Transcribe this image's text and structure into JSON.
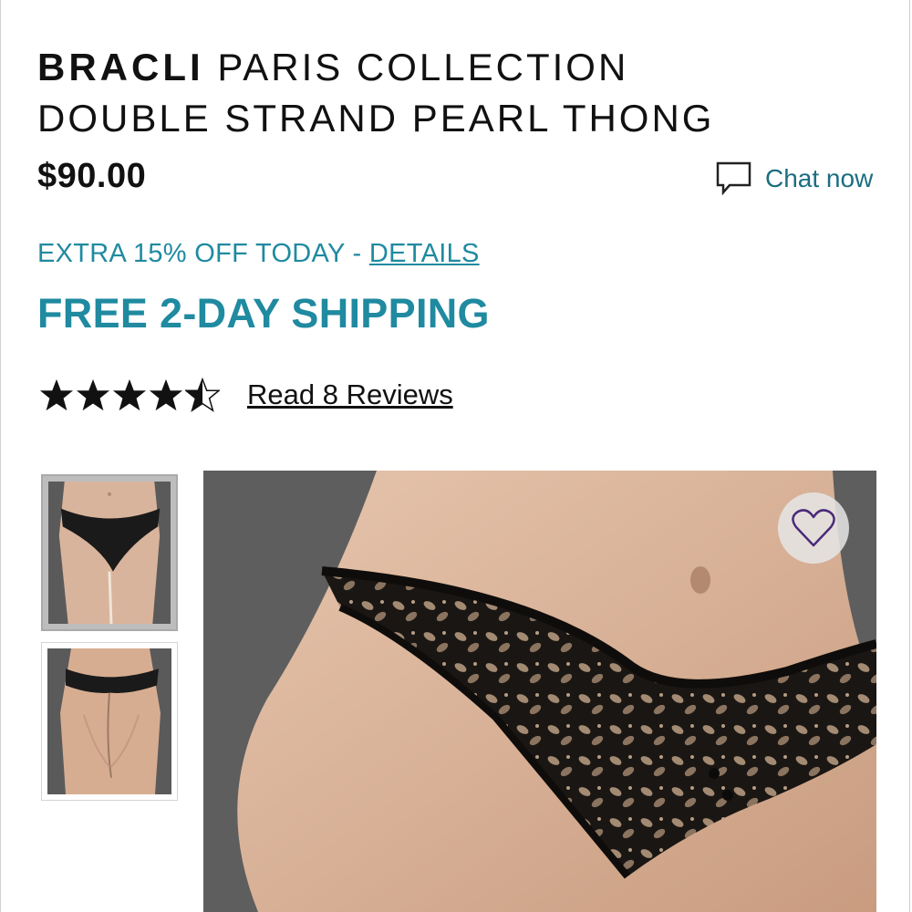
{
  "product": {
    "brand": "BRACLI",
    "name": "PARIS COLLECTION DOUBLE STRAND PEARL THONG",
    "price": "$90.00"
  },
  "chat": {
    "label": "Chat now",
    "icon": "chat-bubble-icon"
  },
  "promo": {
    "text": "EXTRA 15% OFF TODAY - ",
    "link_label": "DETAILS"
  },
  "shipping": {
    "text": "FREE 2-DAY SHIPPING"
  },
  "rating": {
    "value": 4.5,
    "max": 5,
    "reviews_label": "Read 8 Reviews"
  },
  "gallery": {
    "thumbnails": [
      {
        "view": "front",
        "selected": true
      },
      {
        "view": "back",
        "selected": false
      }
    ],
    "favorite_icon": "heart-icon"
  },
  "colors": {
    "accent": "#1f8aa0",
    "chat": "#1a6e80",
    "heart": "#4a2a7a"
  }
}
